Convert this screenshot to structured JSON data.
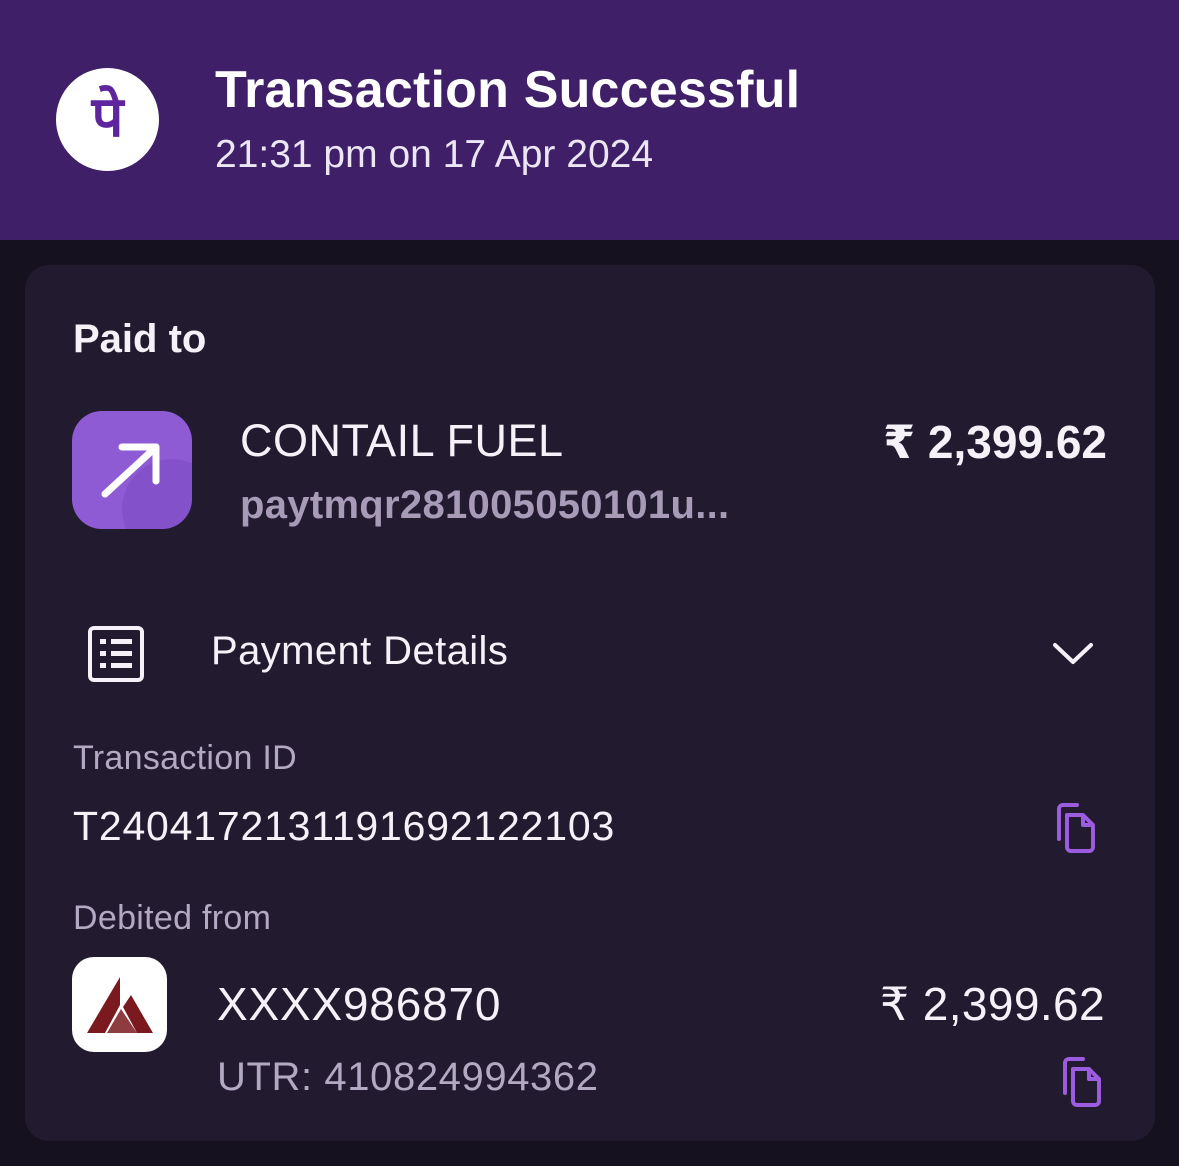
{
  "header": {
    "logo_glyph": "पे",
    "title": "Transaction Successful",
    "timestamp": "21:31 pm on 17 Apr 2024",
    "background": "#3f1f68",
    "logo_color": "#5f259f"
  },
  "paid_to": {
    "label": "Paid to",
    "merchant_name": "CONTAIL FUEL",
    "merchant_upi": "paytmqr281005050101u...",
    "amount": "₹ 2,399.62",
    "icon": "arrow-up-right-icon",
    "icon_color": "#8e5bd4"
  },
  "payment_details": {
    "label": "Payment Details",
    "icon": "receipt-list-icon",
    "chevron": "chevron-down-icon"
  },
  "transaction": {
    "label": "Transaction ID",
    "id": "T2404172131191692122103",
    "copy_icon": "copy-icon"
  },
  "debited_from": {
    "label": "Debited from",
    "account": "XXXX986870",
    "utr": "UTR: 410824994362",
    "amount": "₹ 2,399.62",
    "bank_logo": "axis-bank-logo",
    "bank_logo_color": "#7a1a1f",
    "copy_icon": "copy-icon"
  },
  "accent_color": "#9c5ce0"
}
